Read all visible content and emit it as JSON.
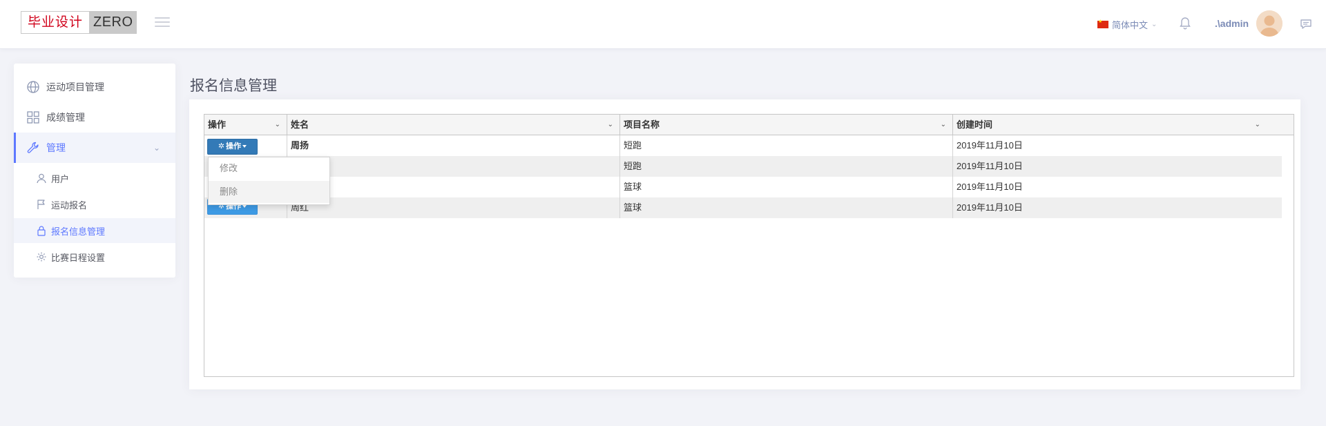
{
  "header": {
    "logo_cn": "毕业设计",
    "logo_en": "ZERO",
    "language": "简体中文",
    "username": ".\\admin",
    "icons": [
      "menu-icon",
      "flag-icon",
      "bell-icon",
      "avatar",
      "message-icon"
    ]
  },
  "sidebar": {
    "items": [
      {
        "label": "运动项目管理",
        "icon": "globe-icon"
      },
      {
        "label": "成绩管理",
        "icon": "grid-icon"
      },
      {
        "label": "管理",
        "icon": "wrench-icon",
        "expanded": true
      }
    ],
    "sub_items": [
      {
        "label": "用户",
        "icon": "user-icon"
      },
      {
        "label": "运动报名",
        "icon": "flag-icon"
      },
      {
        "label": "报名信息管理",
        "icon": "lock-icon",
        "active": true
      },
      {
        "label": "比赛日程设置",
        "icon": "gear-icon"
      }
    ]
  },
  "main": {
    "title": "报名信息管理",
    "columns": [
      "操作",
      "姓名",
      "项目名称",
      "创建时间"
    ],
    "button_label": "操作",
    "rows": [
      {
        "name": "周扬",
        "project": "短跑",
        "created": "2019年11月10日"
      },
      {
        "name": "",
        "project": "短跑",
        "created": "2019年11月10日"
      },
      {
        "name": "",
        "project": "篮球",
        "created": "2019年11月10日"
      },
      {
        "name": "周红",
        "project": "篮球",
        "created": "2019年11月10日"
      }
    ],
    "dropdown": [
      "修改",
      "删除"
    ]
  },
  "colors": {
    "accent": "#5d78ff",
    "button": "#337ab7",
    "logo_red": "#d0021b"
  }
}
